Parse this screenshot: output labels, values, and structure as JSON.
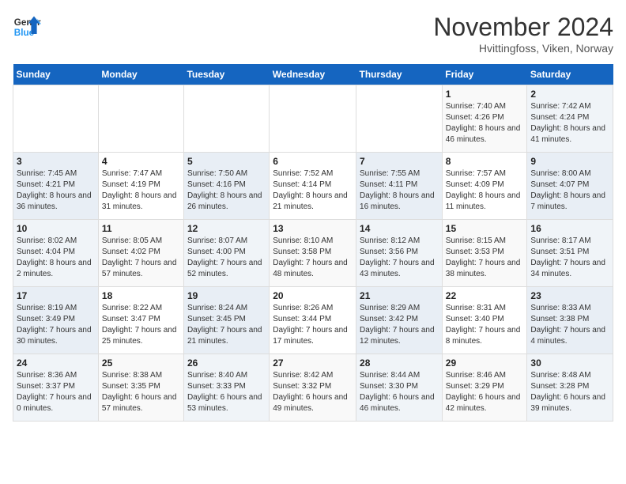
{
  "header": {
    "logo_line1": "General",
    "logo_line2": "Blue",
    "month_title": "November 2024",
    "subtitle": "Hvittingfoss, Viken, Norway"
  },
  "weekdays": [
    "Sunday",
    "Monday",
    "Tuesday",
    "Wednesday",
    "Thursday",
    "Friday",
    "Saturday"
  ],
  "weeks": [
    [
      {
        "day": "",
        "info": ""
      },
      {
        "day": "",
        "info": ""
      },
      {
        "day": "",
        "info": ""
      },
      {
        "day": "",
        "info": ""
      },
      {
        "day": "",
        "info": ""
      },
      {
        "day": "1",
        "info": "Sunrise: 7:40 AM\nSunset: 4:26 PM\nDaylight: 8 hours and 46 minutes."
      },
      {
        "day": "2",
        "info": "Sunrise: 7:42 AM\nSunset: 4:24 PM\nDaylight: 8 hours and 41 minutes."
      }
    ],
    [
      {
        "day": "3",
        "info": "Sunrise: 7:45 AM\nSunset: 4:21 PM\nDaylight: 8 hours and 36 minutes."
      },
      {
        "day": "4",
        "info": "Sunrise: 7:47 AM\nSunset: 4:19 PM\nDaylight: 8 hours and 31 minutes."
      },
      {
        "day": "5",
        "info": "Sunrise: 7:50 AM\nSunset: 4:16 PM\nDaylight: 8 hours and 26 minutes."
      },
      {
        "day": "6",
        "info": "Sunrise: 7:52 AM\nSunset: 4:14 PM\nDaylight: 8 hours and 21 minutes."
      },
      {
        "day": "7",
        "info": "Sunrise: 7:55 AM\nSunset: 4:11 PM\nDaylight: 8 hours and 16 minutes."
      },
      {
        "day": "8",
        "info": "Sunrise: 7:57 AM\nSunset: 4:09 PM\nDaylight: 8 hours and 11 minutes."
      },
      {
        "day": "9",
        "info": "Sunrise: 8:00 AM\nSunset: 4:07 PM\nDaylight: 8 hours and 7 minutes."
      }
    ],
    [
      {
        "day": "10",
        "info": "Sunrise: 8:02 AM\nSunset: 4:04 PM\nDaylight: 8 hours and 2 minutes."
      },
      {
        "day": "11",
        "info": "Sunrise: 8:05 AM\nSunset: 4:02 PM\nDaylight: 7 hours and 57 minutes."
      },
      {
        "day": "12",
        "info": "Sunrise: 8:07 AM\nSunset: 4:00 PM\nDaylight: 7 hours and 52 minutes."
      },
      {
        "day": "13",
        "info": "Sunrise: 8:10 AM\nSunset: 3:58 PM\nDaylight: 7 hours and 48 minutes."
      },
      {
        "day": "14",
        "info": "Sunrise: 8:12 AM\nSunset: 3:56 PM\nDaylight: 7 hours and 43 minutes."
      },
      {
        "day": "15",
        "info": "Sunrise: 8:15 AM\nSunset: 3:53 PM\nDaylight: 7 hours and 38 minutes."
      },
      {
        "day": "16",
        "info": "Sunrise: 8:17 AM\nSunset: 3:51 PM\nDaylight: 7 hours and 34 minutes."
      }
    ],
    [
      {
        "day": "17",
        "info": "Sunrise: 8:19 AM\nSunset: 3:49 PM\nDaylight: 7 hours and 30 minutes."
      },
      {
        "day": "18",
        "info": "Sunrise: 8:22 AM\nSunset: 3:47 PM\nDaylight: 7 hours and 25 minutes."
      },
      {
        "day": "19",
        "info": "Sunrise: 8:24 AM\nSunset: 3:45 PM\nDaylight: 7 hours and 21 minutes."
      },
      {
        "day": "20",
        "info": "Sunrise: 8:26 AM\nSunset: 3:44 PM\nDaylight: 7 hours and 17 minutes."
      },
      {
        "day": "21",
        "info": "Sunrise: 8:29 AM\nSunset: 3:42 PM\nDaylight: 7 hours and 12 minutes."
      },
      {
        "day": "22",
        "info": "Sunrise: 8:31 AM\nSunset: 3:40 PM\nDaylight: 7 hours and 8 minutes."
      },
      {
        "day": "23",
        "info": "Sunrise: 8:33 AM\nSunset: 3:38 PM\nDaylight: 7 hours and 4 minutes."
      }
    ],
    [
      {
        "day": "24",
        "info": "Sunrise: 8:36 AM\nSunset: 3:37 PM\nDaylight: 7 hours and 0 minutes."
      },
      {
        "day": "25",
        "info": "Sunrise: 8:38 AM\nSunset: 3:35 PM\nDaylight: 6 hours and 57 minutes."
      },
      {
        "day": "26",
        "info": "Sunrise: 8:40 AM\nSunset: 3:33 PM\nDaylight: 6 hours and 53 minutes."
      },
      {
        "day": "27",
        "info": "Sunrise: 8:42 AM\nSunset: 3:32 PM\nDaylight: 6 hours and 49 minutes."
      },
      {
        "day": "28",
        "info": "Sunrise: 8:44 AM\nSunset: 3:30 PM\nDaylight: 6 hours and 46 minutes."
      },
      {
        "day": "29",
        "info": "Sunrise: 8:46 AM\nSunset: 3:29 PM\nDaylight: 6 hours and 42 minutes."
      },
      {
        "day": "30",
        "info": "Sunrise: 8:48 AM\nSunset: 3:28 PM\nDaylight: 6 hours and 39 minutes."
      }
    ]
  ]
}
